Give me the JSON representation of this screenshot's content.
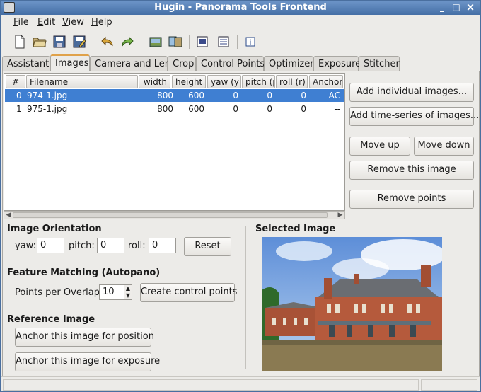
{
  "window": {
    "title": "Hugin - Panorama Tools Frontend",
    "minimize": "_",
    "maximize": "□",
    "close": "×"
  },
  "menu": [
    {
      "key": "F",
      "rest": "ile"
    },
    {
      "key": "E",
      "rest": "dit"
    },
    {
      "key": "V",
      "rest": "iew"
    },
    {
      "key": "H",
      "rest": "elp"
    }
  ],
  "toolbar": [
    "new-icon",
    "open-icon",
    "save-icon",
    "save-as-icon",
    "undo-icon",
    "redo-icon",
    "images-icon",
    "control-points-icon",
    "preview-icon",
    "fast-preview-icon",
    "info-icon"
  ],
  "tabs": [
    "Assistant",
    "Images",
    "Camera and Lens",
    "Crop",
    "Control Points",
    "Optimizer",
    "Exposure",
    "Stitcher"
  ],
  "active_tab": "Images",
  "images_table": {
    "columns": [
      "#",
      "Filename",
      "width",
      "height",
      "yaw (y)",
      "pitch (p",
      "roll (r)",
      "Anchor"
    ],
    "rows": [
      {
        "idx": "0",
        "filename": "974-1.jpg",
        "width": "800",
        "height": "600",
        "yaw": "0",
        "pitch": "0",
        "roll": "0",
        "anchor": "AC",
        "selected": true
      },
      {
        "idx": "1",
        "filename": "975-1.jpg",
        "width": "800",
        "height": "600",
        "yaw": "0",
        "pitch": "0",
        "roll": "0",
        "anchor": "--",
        "selected": false
      }
    ]
  },
  "side_buttons": {
    "add_individual": "Add individual images...",
    "add_time_series": "Add time-series of images...",
    "move_up": "Move up",
    "move_down": "Move down",
    "remove_image": "Remove this image",
    "remove_points": "Remove points"
  },
  "orientation": {
    "heading": "Image Orientation",
    "yaw_label": "yaw:",
    "yaw_value": "0",
    "pitch_label": "pitch:",
    "pitch_value": "0",
    "roll_label": "roll:",
    "roll_value": "0",
    "reset_label": "Reset"
  },
  "feature_matching": {
    "heading": "Feature Matching (Autopano)",
    "points_label": "Points per Overlap:",
    "points_value": "10",
    "create_label": "Create control points"
  },
  "reference": {
    "heading": "Reference Image",
    "anchor_position": "Anchor this image for position",
    "anchor_exposure": "Anchor this image for exposure"
  },
  "selected_image": {
    "heading": "Selected Image"
  },
  "colors": {
    "selection": "#3f7fd2",
    "titlebar": "#456fa6",
    "active_tab_accent": "#e0a24a"
  }
}
